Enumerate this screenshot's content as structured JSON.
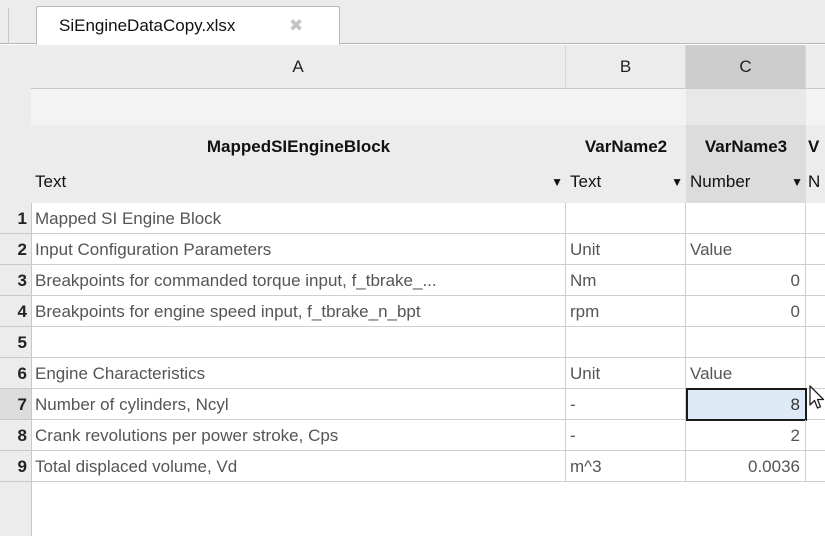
{
  "tab": {
    "title": "SiEngineDataCopy.xlsx",
    "close_glyph": "✖"
  },
  "columns": [
    {
      "letter": "A",
      "varname": "MappedSIEngineBlock",
      "type": "Text",
      "type_arrow": "▼"
    },
    {
      "letter": "B",
      "varname": "VarName2",
      "type": "Text",
      "type_arrow": "▼"
    },
    {
      "letter": "C",
      "varname": "VarName3",
      "type": "Number",
      "type_arrow": "▼"
    },
    {
      "letter": "",
      "varname": "V",
      "type": "N",
      "type_arrow": ""
    }
  ],
  "selected_column": "C",
  "rows": [
    {
      "n": "1",
      "a": "Mapped SI Engine Block",
      "b": "",
      "c": ""
    },
    {
      "n": "2",
      "a": "Input Configuration Parameters",
      "b": "Unit",
      "c": "Value"
    },
    {
      "n": "3",
      "a": "Breakpoints for commanded torque input, f_tbrake_...",
      "b": "Nm",
      "c": "0"
    },
    {
      "n": "4",
      "a": "Breakpoints for engine speed input, f_tbrake_n_bpt",
      "b": "rpm",
      "c": "0"
    },
    {
      "n": "5",
      "a": "",
      "b": "",
      "c": ""
    },
    {
      "n": "6",
      "a": "Engine Characteristics",
      "b": "Unit",
      "c": "Value"
    },
    {
      "n": "7",
      "a": "Number of cylinders, Ncyl",
      "b": "-",
      "c": "8"
    },
    {
      "n": "8",
      "a": "Crank revolutions per power stroke, Cps",
      "b": "-",
      "c": "2"
    },
    {
      "n": "9",
      "a": "Total displaced volume, Vd",
      "b": "m^3",
      "c": "0.0036"
    }
  ],
  "active_cell": {
    "row": "7",
    "col": "C"
  }
}
